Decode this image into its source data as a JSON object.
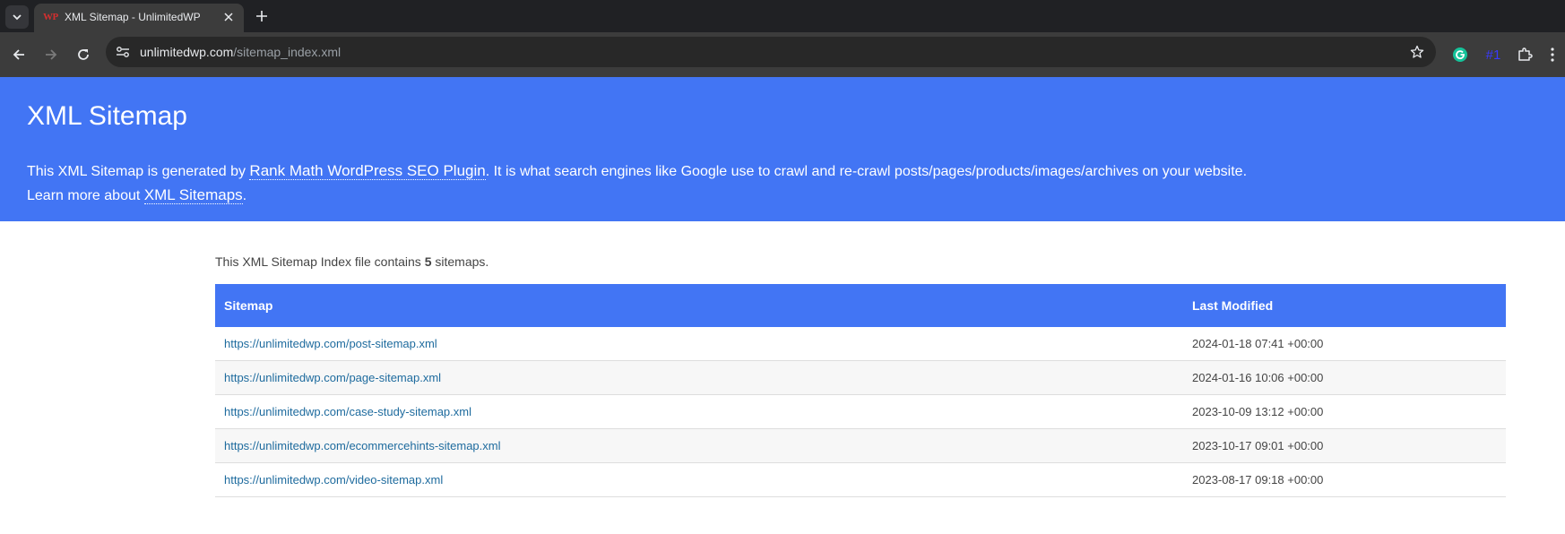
{
  "browser": {
    "tab": {
      "favicon_text": "WP",
      "title": "XML Sitemap - UnlimitedWP"
    },
    "url_host": "unlimitedwp.com",
    "url_path": "/sitemap_index.xml",
    "extension_badge": "#1"
  },
  "hero": {
    "title": "XML Sitemap",
    "line1_pre": "This XML Sitemap is generated by ",
    "line1_link": "Rank Math WordPress SEO Plugin",
    "line1_post": ". It is what search engines like Google use to crawl and re-crawl posts/pages/products/images/archives on your website.",
    "line2_pre": "Learn more about ",
    "line2_link": "XML Sitemaps",
    "line2_post": "."
  },
  "intro": {
    "pre": "This XML Sitemap Index file contains ",
    "count": "5",
    "post": " sitemaps."
  },
  "table": {
    "headers": [
      "Sitemap",
      "Last Modified"
    ],
    "rows": [
      {
        "url": "https://unlimitedwp.com/post-sitemap.xml",
        "modified": "2024-01-18 07:41 +00:00"
      },
      {
        "url": "https://unlimitedwp.com/page-sitemap.xml",
        "modified": "2024-01-16 10:06 +00:00"
      },
      {
        "url": "https://unlimitedwp.com/case-study-sitemap.xml",
        "modified": "2023-10-09 13:12 +00:00"
      },
      {
        "url": "https://unlimitedwp.com/ecommercehints-sitemap.xml",
        "modified": "2023-10-17 09:01 +00:00"
      },
      {
        "url": "https://unlimitedwp.com/video-sitemap.xml",
        "modified": "2023-08-17 09:18 +00:00"
      }
    ]
  },
  "colors": {
    "hero_bg": "#4275f4",
    "link": "#1e6b9e",
    "browser_frame": "#202124"
  }
}
